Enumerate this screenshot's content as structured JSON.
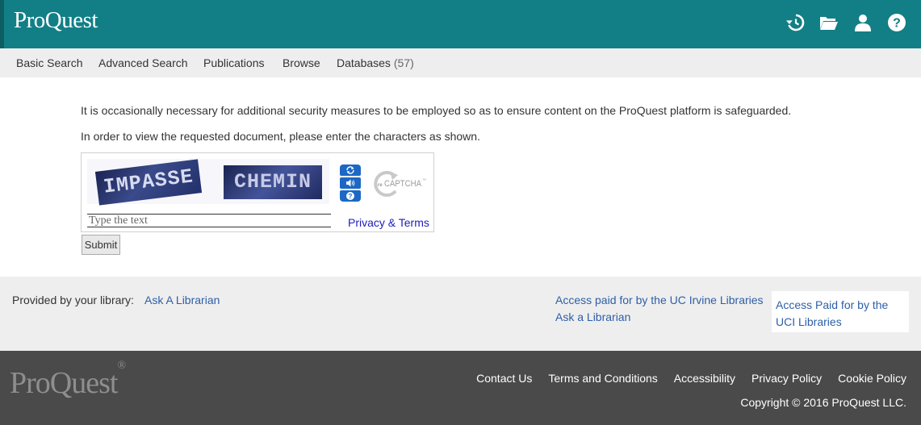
{
  "header": {
    "logo": "ProQuest",
    "icons": [
      "history-icon",
      "folder-icon",
      "user-icon",
      "help-icon"
    ],
    "color": "#127f86"
  },
  "nav": {
    "items": [
      {
        "label": "Basic Search"
      },
      {
        "label": "Advanced Search"
      },
      {
        "label": "Publications"
      },
      {
        "label": "Browse"
      },
      {
        "label": "Databases",
        "count": "(57)"
      }
    ]
  },
  "main": {
    "message1": "It is occasionally necessary for additional security measures to be employed so as to ensure content on the ProQuest platform is safeguarded.",
    "message2": "In order to view the requested document, please enter the characters as shown.",
    "captcha": {
      "word1": "IMPASSE",
      "word2": "CHEMIN",
      "input_placeholder": "Type the text",
      "input_value": "",
      "privacy_link": "Privacy & Terms",
      "logo_prefix": "re",
      "logo_text": "CAPTCHA",
      "logo_tm": "™"
    },
    "submit_label": "Submit"
  },
  "library": {
    "provided_label": "Provided by your library:",
    "ask_link": "Ask A Librarian",
    "access_line": "Access paid for by the UC Irvine Libraries",
    "ask_line": "Ask a Librarian",
    "box_text": "Access Paid for by the UCI Libraries"
  },
  "footer": {
    "logo": "ProQuest",
    "logo_mark": "®",
    "links": [
      "Contact Us",
      "Terms and Conditions",
      "Accessibility",
      "Privacy Policy",
      "Cookie Policy"
    ],
    "copyright": "Copyright © 2016 ProQuest LLC."
  }
}
